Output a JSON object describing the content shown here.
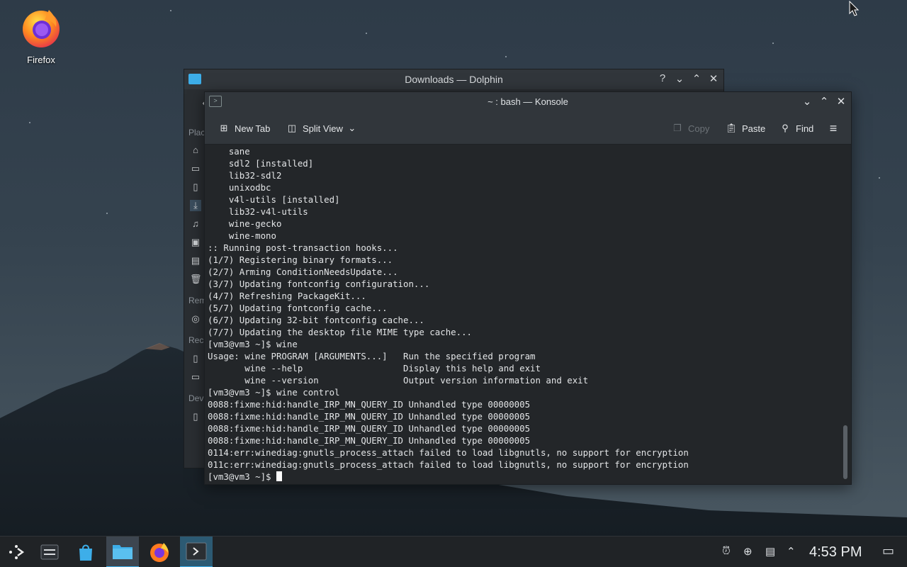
{
  "desktop": {
    "icon_label": "Firefox"
  },
  "dolphin": {
    "title": "Downloads — Dolphin",
    "sidebar_sections": [
      "Plac",
      "Rem",
      "Rec",
      "Dev"
    ],
    "controls": [
      "?",
      "⌄",
      "⌃",
      "✕"
    ]
  },
  "konsole": {
    "title": "~ : bash — Konsole",
    "toolbar": {
      "new_tab": "New Tab",
      "split_view": "Split View",
      "copy": "Copy",
      "paste": "Paste",
      "find": "Find"
    },
    "lines": [
      "    sane",
      "    sdl2 [installed]",
      "    lib32-sdl2",
      "    unixodbc",
      "    v4l-utils [installed]",
      "    lib32-v4l-utils",
      "    wine-gecko",
      "    wine-mono",
      ":: Running post-transaction hooks...",
      "(1/7) Registering binary formats...",
      "(2/7) Arming ConditionNeedsUpdate...",
      "(3/7) Updating fontconfig configuration...",
      "(4/7) Refreshing PackageKit...",
      "(5/7) Updating fontconfig cache...",
      "(6/7) Updating 32-bit fontconfig cache...",
      "(7/7) Updating the desktop file MIME type cache...",
      "[vm3@vm3 ~]$ wine",
      "Usage: wine PROGRAM [ARGUMENTS...]   Run the specified program",
      "       wine --help                   Display this help and exit",
      "       wine --version                Output version information and exit",
      "[vm3@vm3 ~]$ wine control",
      "0088:fixme:hid:handle_IRP_MN_QUERY_ID Unhandled type 00000005",
      "0088:fixme:hid:handle_IRP_MN_QUERY_ID Unhandled type 00000005",
      "0088:fixme:hid:handle_IRP_MN_QUERY_ID Unhandled type 00000005",
      "0088:fixme:hid:handle_IRP_MN_QUERY_ID Unhandled type 00000005",
      "0114:err:winediag:gnutls_process_attach failed to load libgnutls, no support for encryption",
      "011c:err:winediag:gnutls_process_attach failed to load libgnutls, no support for encryption"
    ],
    "prompt": "[vm3@vm3 ~]$ "
  },
  "taskbar": {
    "clock": "4:53 PM"
  },
  "colors": {
    "accent": "#3daee9",
    "terminal_bg": "#232629",
    "titlebar": "#31363b"
  }
}
